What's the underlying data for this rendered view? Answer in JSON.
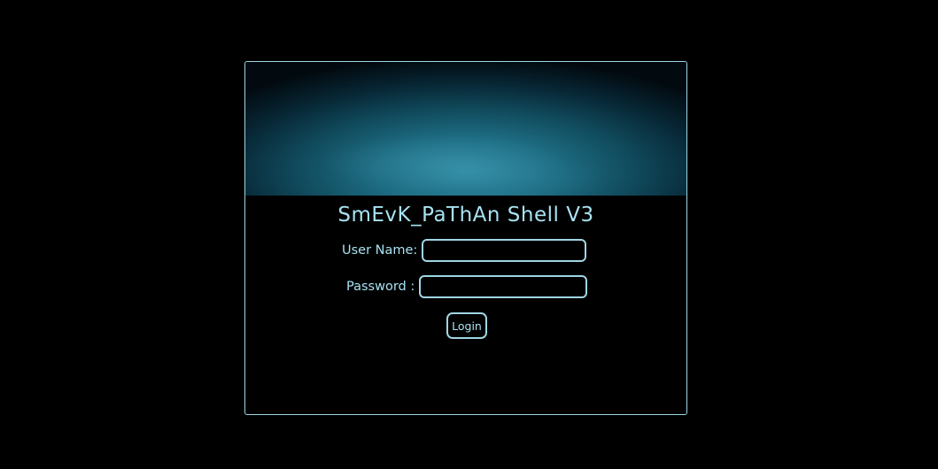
{
  "login": {
    "title": "SmEvK_PaThAn Shell V3",
    "username_label": "User Name:",
    "username_value": "",
    "password_label": "Password :",
    "password_value": "",
    "submit_label": "Login"
  },
  "colors": {
    "background": "#000000",
    "accent": "#a8e2f2",
    "border": "#9fd6e4",
    "banner_glow": "#2f8aa2"
  }
}
